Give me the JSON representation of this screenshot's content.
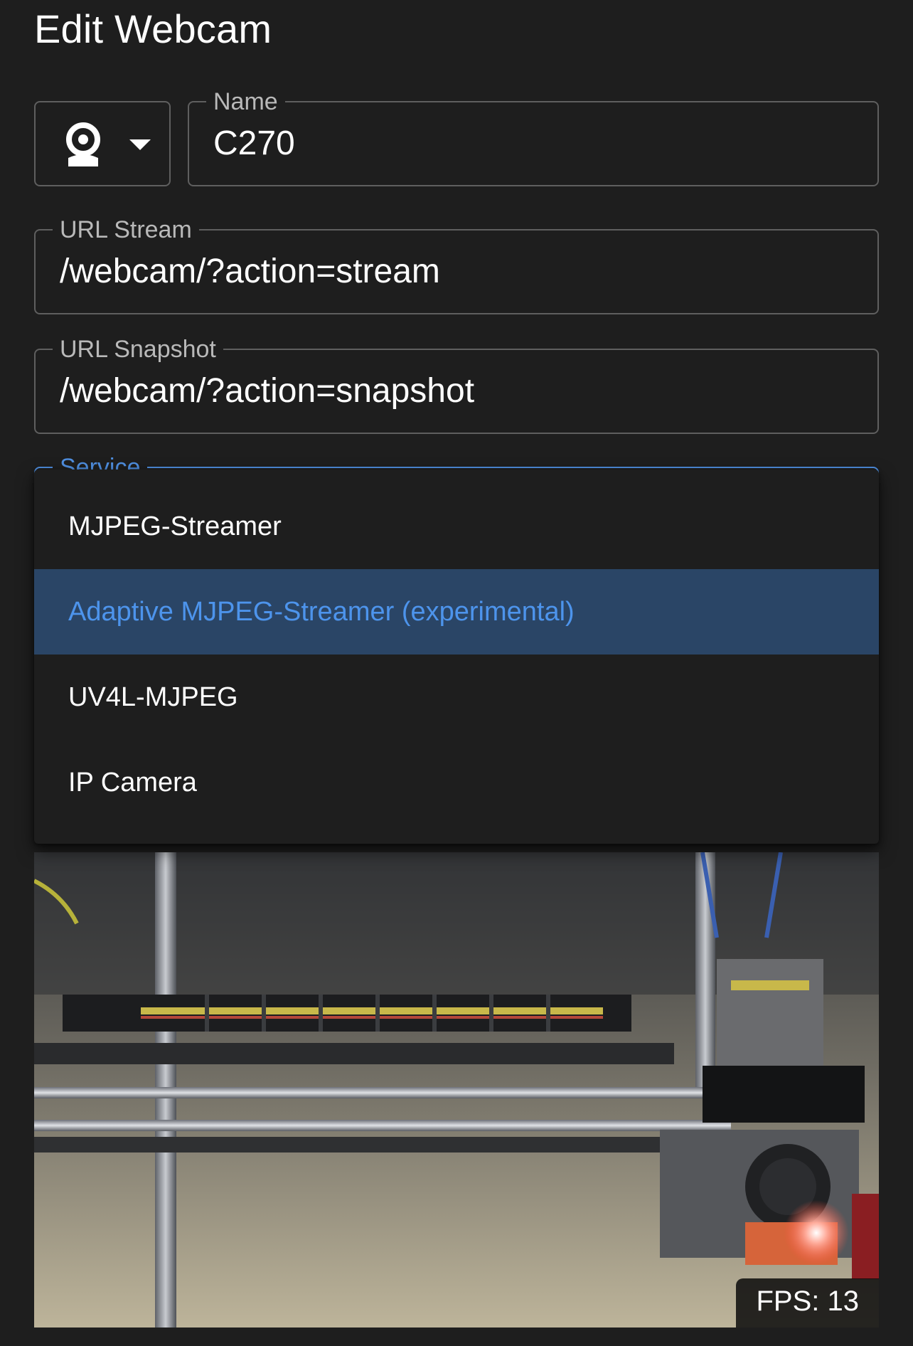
{
  "page": {
    "title": "Edit Webcam"
  },
  "icon_select": {
    "icon": "webcam-icon",
    "caret": "caret-down-icon"
  },
  "fields": {
    "name": {
      "label": "Name",
      "value": "C270"
    },
    "url_stream": {
      "label": "URL Stream",
      "value": "/webcam/?action=stream"
    },
    "url_snapshot": {
      "label": "URL Snapshot",
      "value": "/webcam/?action=snapshot"
    },
    "service": {
      "label": "Service"
    }
  },
  "service_menu": {
    "items": [
      {
        "label": "MJPEG-Streamer",
        "selected": false
      },
      {
        "label": "Adaptive MJPEG-Streamer (experimental)",
        "selected": true
      },
      {
        "label": "UV4L-MJPEG",
        "selected": false
      },
      {
        "label": "IP Camera",
        "selected": false
      }
    ]
  },
  "preview": {
    "fps_label": "FPS: 13"
  },
  "colors": {
    "background": "#1e1e1e",
    "accent": "#4d94ec",
    "selected_bg": "#2a4566",
    "outline": "#5f5f5f"
  }
}
